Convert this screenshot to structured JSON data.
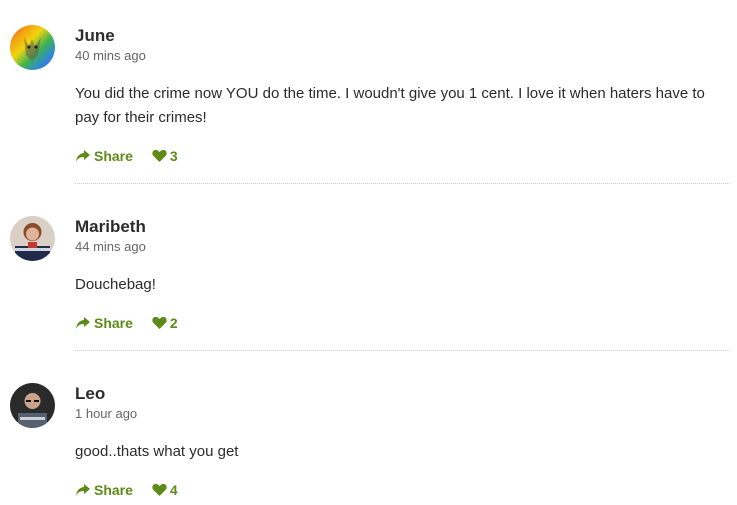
{
  "comments": [
    {
      "author": "June",
      "time": "40 mins ago",
      "text": "You did the crime now YOU do the time. I woudn't give you 1 cent. I love it when haters have to pay for their crimes!",
      "share_label": "Share",
      "likes": "3",
      "avatar_icon": "rainbow-avatar"
    },
    {
      "author": "Maribeth",
      "time": "44 mins ago",
      "text": "Douchebag!",
      "share_label": "Share",
      "likes": "2",
      "avatar_icon": "person-avatar"
    },
    {
      "author": "Leo",
      "time": "1 hour ago",
      "text": "good..thats what you get",
      "share_label": "Share",
      "likes": "4",
      "avatar_icon": "person-avatar"
    }
  ],
  "colors": {
    "accent": "#5e8a18",
    "text": "#2b2b2b",
    "muted": "#666666"
  }
}
